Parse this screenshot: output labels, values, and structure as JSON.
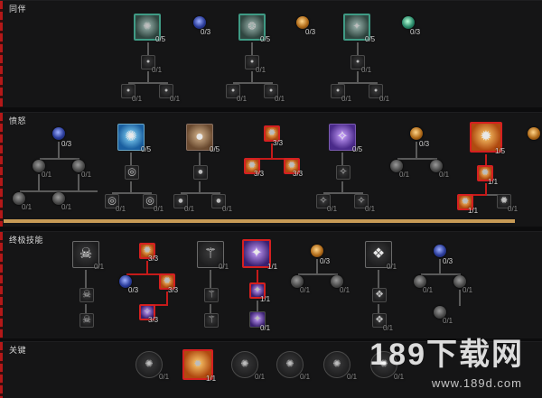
{
  "sections": [
    {
      "title": "同伴"
    },
    {
      "title": "愤怒"
    },
    {
      "title": "终极技能"
    },
    {
      "title": "关键"
    }
  ],
  "counts": {
    "c1": "0/5",
    "c2": "0/3",
    "c3": "0/5",
    "c4": "0/3",
    "c5": "0/5",
    "c6": "0/3",
    "c7": "0/1",
    "c8": "0/1",
    "c9": "0/1",
    "c10": "0/1",
    "c11": "0/1",
    "c12": "0/1",
    "c13": "0/1",
    "c14": "0/1",
    "c15": "0/1",
    "w1": "0/3",
    "w2": "0/1",
    "w3": "0/1",
    "w4": "0/1",
    "w5": "0/1",
    "w6": "0/5",
    "w7": "0/1",
    "w8": "0/1",
    "w9": "0/5",
    "w10": "0/1",
    "w11": "0/1",
    "w12": "3/3",
    "w13": "3/3",
    "w14": "3/3",
    "w15": "0/5",
    "w16": "0/1",
    "w17": "0/1",
    "w18": "0/3",
    "w19": "0/1",
    "w20": "0/1",
    "w21": "1/5",
    "w22": "1/1",
    "w23": "1/1",
    "w24": "0/1",
    "u1": "0/1",
    "u2": "3/3",
    "u3": "0/3",
    "u4": "3/3",
    "u5": "3/3",
    "u6": "0/1",
    "u7": "0/1",
    "u8": "0/1",
    "u9": "0/1",
    "u10": "0/1",
    "u11": "1/1",
    "u12": "1/1",
    "u13": "0/1",
    "u14": "0/3",
    "u15": "0/1",
    "u16": "0/1",
    "u17": "0/1",
    "u18": "0/1",
    "u19": "0/3",
    "u20": "0/1",
    "u21": "0/1",
    "u22": "0/1",
    "k1": "0/1",
    "k2": "1/1",
    "k3": "0/1",
    "k4": "0/1",
    "k5": "0/1",
    "k6": "0/1"
  },
  "watermark": {
    "brand": "189下载网",
    "url": "www.189d.com"
  },
  "colors": {
    "accent_red": "#d52020",
    "teal": "#3f9a84",
    "divider_gold": "#c79a55"
  }
}
